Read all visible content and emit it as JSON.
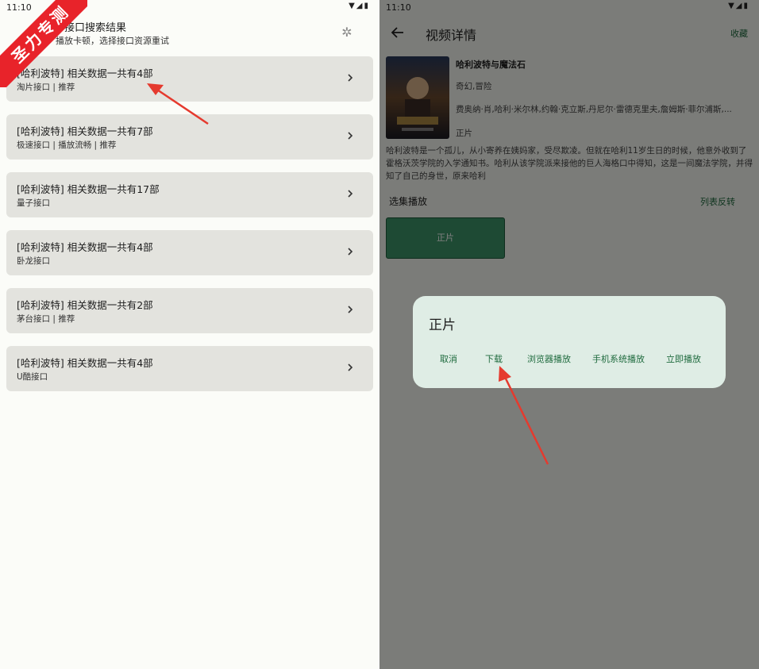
{
  "ribbon": {
    "text": "圣力专测"
  },
  "left": {
    "status_time": "11:10",
    "title": "多接口搜索结果",
    "subtitle": "播放卡顿，选择接口资源重试",
    "results": [
      {
        "title": "[哈利波特] 相关数据一共有4部",
        "tags": "淘片接口 | 推荐"
      },
      {
        "title": "[哈利波特] 相关数据一共有7部",
        "tags": "极速接口 | 播放流畅 | 推荐"
      },
      {
        "title": "[哈利波特] 相关数据一共有17部",
        "tags": "量子接口"
      },
      {
        "title": "[哈利波特] 相关数据一共有4部",
        "tags": "卧龙接口"
      },
      {
        "title": "[哈利波特] 相关数据一共有2部",
        "tags": "茅台接口 | 推荐"
      },
      {
        "title": "[哈利波特] 相关数据一共有4部",
        "tags": "U酷接口"
      }
    ]
  },
  "right": {
    "status_time": "11:10",
    "header": {
      "title": "视频详情",
      "fav_label": "收藏"
    },
    "movie": {
      "name": "哈利波特与魔法石",
      "genre": "奇幻,冒险",
      "cast": "费奥纳·肖,哈利·米尔林,约翰·克立斯,丹尼尔·雷德克里夫,詹姆斯·菲尔浦斯,...",
      "type": "正片",
      "description": "哈利波特是一个孤儿，从小寄养在姨妈家，受尽欺凌。但就在哈利11岁生日的时候，他意外收到了霍格沃茨学院的入学通知书。哈利从该学院派来接他的巨人海格口中得知，这是一间魔法学院，并得知了自己的身世，原来哈利"
    },
    "episodes": {
      "label": "选集播放",
      "reverse_label": "列表反转",
      "items": [
        "正片"
      ]
    },
    "dialog": {
      "title": "正片",
      "actions": [
        "取消",
        "下载",
        "浏览器播放",
        "手机系统播放",
        "立即播放"
      ]
    }
  },
  "colors": {
    "accent_green": "#1f6b3e",
    "episode_green": "#3d9468",
    "ribbon_red": "#e8232a",
    "arrow_red": "#e53a2e"
  }
}
